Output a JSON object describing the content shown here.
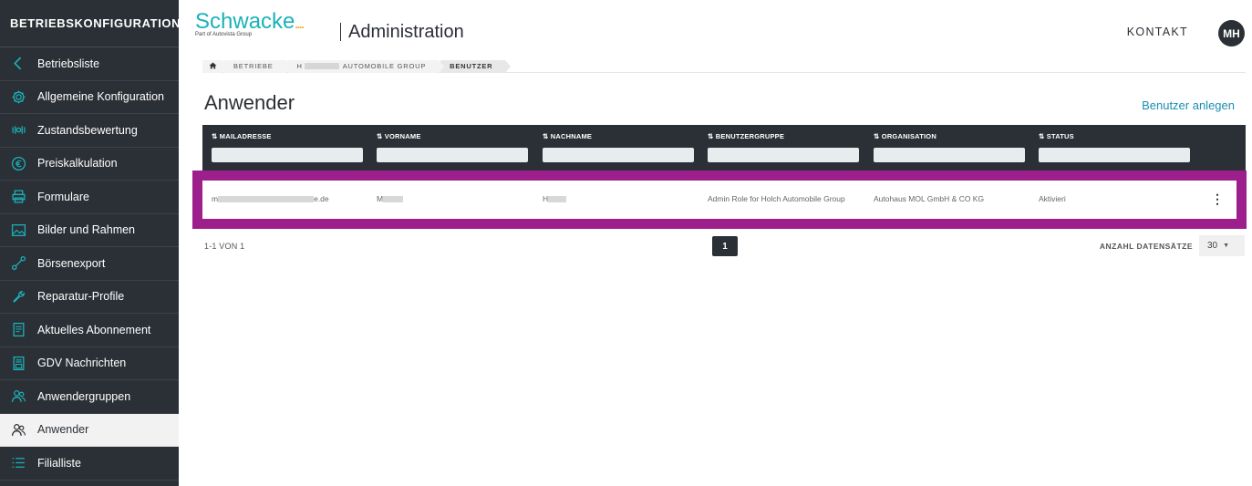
{
  "sidebar": {
    "title": "BETRIEBSKONFIGURATION",
    "items": [
      {
        "label": "Betriebsliste",
        "icon": "chevron-left-icon"
      },
      {
        "label": "Allgemeine Konfiguration",
        "icon": "gear-icon"
      },
      {
        "label": "Zustandsbewertung",
        "icon": "gauge-icon"
      },
      {
        "label": "Preiskalkulation",
        "icon": "euro-icon"
      },
      {
        "label": "Formulare",
        "icon": "printer-icon"
      },
      {
        "label": "Bilder und Rahmen",
        "icon": "image-icon"
      },
      {
        "label": "Börsenexport",
        "icon": "share-icon"
      },
      {
        "label": "Reparatur-Profile",
        "icon": "wrench-icon"
      },
      {
        "label": "Aktuelles Abonnement",
        "icon": "document-icon"
      },
      {
        "label": "GDV Nachrichten",
        "icon": "message-document-icon"
      },
      {
        "label": "Anwendergruppen",
        "icon": "users-icon"
      },
      {
        "label": "Anwender",
        "icon": "users-icon",
        "active": true
      },
      {
        "label": "Filialliste",
        "icon": "list-icon"
      }
    ]
  },
  "header": {
    "logo_text": "Schwacke",
    "logo_dots": "....",
    "logo_subtitle": "Part of Autovista Group",
    "title": "Administration",
    "kontakt": "KONTAKT",
    "avatar_initials": "MH"
  },
  "breadcrumb": {
    "item_betriebe": "BETRIEBE",
    "item_group_prefix": "H",
    "item_group_suffix": "AUTOMOBILE GROUP",
    "item_benutzer": "BENUTZER"
  },
  "page": {
    "title": "Anwender",
    "add_user": "Benutzer anlegen"
  },
  "table": {
    "columns": [
      "MAILADRESSE",
      "VORNAME",
      "NACHNAME",
      "BENUTZERGRUPPE",
      "ORGANISATION",
      "STATUS"
    ],
    "sort_glyph": "⇅",
    "row": {
      "mail_prefix": "m",
      "mail_suffix": "e.de",
      "vorname_prefix": "M",
      "nachname_prefix": "H",
      "benutzergruppe": "Admin Role for Holch Automobile Group",
      "organisation": "Autohaus MOL GmbH & CO KG",
      "status": "Aktivieri"
    }
  },
  "pagination": {
    "info": "1-1 VON 1",
    "current_page": "1",
    "page_size_label": "ANZAHL DATENSÄTZE",
    "page_size": "30"
  },
  "colors": {
    "sidebar_bg": "#2b3036",
    "accent": "#1ab2b8",
    "highlight": "#9c1f8c",
    "link": "#1a8fb0"
  }
}
